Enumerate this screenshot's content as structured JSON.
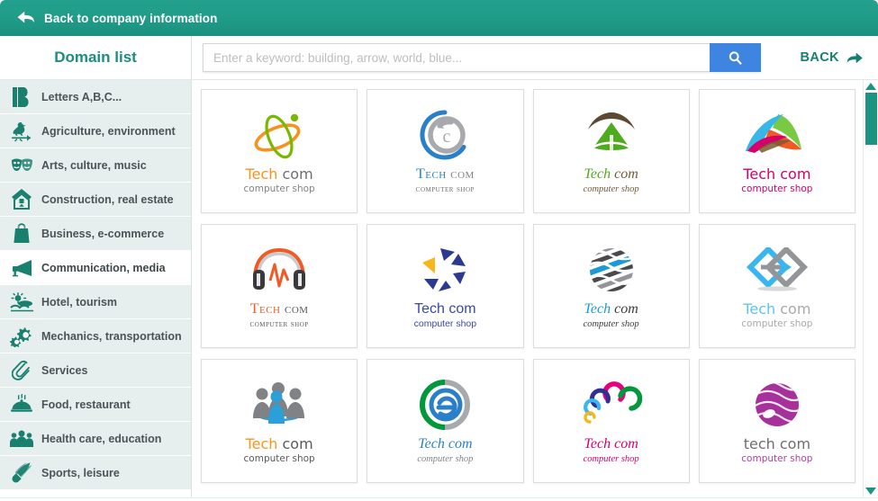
{
  "topbar": {
    "back_label": "Back to company information",
    "back_icon": "back-arrow-icon",
    "bg_color": "#1f9b88"
  },
  "sidebar": {
    "title": "Domain list",
    "title_color": "#1b8e7d",
    "items": [
      {
        "label": "Letters A,B,C...",
        "icon": "letter-b-icon",
        "active": false
      },
      {
        "label": "Agriculture, environment",
        "icon": "rooster-vane-icon",
        "active": false
      },
      {
        "label": "Arts, culture, music",
        "icon": "theatre-masks-icon",
        "active": false
      },
      {
        "label": "Construction, real estate",
        "icon": "house-icon",
        "active": false
      },
      {
        "label": "Business, e-commerce",
        "icon": "shopping-bag-icon",
        "active": false
      },
      {
        "label": "Communication, media",
        "icon": "megaphone-icon",
        "active": true
      },
      {
        "label": "Hotel, tourism",
        "icon": "beach-sun-icon",
        "active": false
      },
      {
        "label": "Mechanics, transportation",
        "icon": "gears-icon",
        "active": false
      },
      {
        "label": "Services",
        "icon": "paperclip-icon",
        "active": false
      },
      {
        "label": "Food, restaurant",
        "icon": "food-cloche-icon",
        "active": false
      },
      {
        "label": "Health care, education",
        "icon": "people-group-icon",
        "active": false
      },
      {
        "label": "Sports, leisure",
        "icon": "shuttlecock-icon",
        "active": false
      }
    ]
  },
  "search": {
    "value": "",
    "placeholder": "Enter a keyword: building, arrow, world, blue...",
    "button_icon": "search-icon",
    "button_color": "#3d85e0"
  },
  "back_right": {
    "label": "BACK",
    "icon": "arrow-right-icon",
    "color": "#16806f"
  },
  "scrollbar": {
    "up_icon": "triangle-up-icon",
    "down_icon": "triangle-down-icon",
    "thumb_color": "#1d9382"
  },
  "logos": [
    {
      "id": "atom-orbit",
      "mark_icon": "atom-orbit-icon",
      "name_part1": "Tech",
      "name_part2": "com",
      "tagline": "computer shop",
      "color1": "#f6921e",
      "color2": "#7ab800",
      "name1_color": "#f6921e",
      "name2_color": "#6d6e71",
      "tagline_color": "#808285",
      "font_style": "round"
    },
    {
      "id": "c-circle",
      "mark_icon": "c-circle-icon",
      "name_part1": "Tech",
      "name_part2": "com",
      "tagline": "computer shop",
      "color1": "#2a7fc9",
      "color2": "#a7a9ac",
      "name1_color": "#2a7fc9",
      "name2_color": "#808285",
      "tagline_color": "#6d6e71",
      "font_style": "serif"
    },
    {
      "id": "green-tent",
      "mark_icon": "tent-tree-icon",
      "name_part1": "Tech",
      "name_part2": "com",
      "tagline": "computer shop",
      "color1": "#5a4a2f",
      "color2": "#4faa1e",
      "name1_color": "#4faa1e",
      "name2_color": "#6e5c3a",
      "tagline_color": "#6e5c3a",
      "font_style": "ital"
    },
    {
      "id": "color-wings",
      "mark_icon": "colored-wings-icon",
      "name_part1": "Tech",
      "name_part2": "com",
      "tagline": "computer shop",
      "color1": "#e6007e",
      "color2": "#7ac943",
      "name1_color": "#d4006a",
      "name2_color": "#d4006a",
      "tagline_color": "#d4006a",
      "font_style": "round"
    },
    {
      "id": "headphones",
      "mark_icon": "headphones-icon",
      "name_part1": "Tech",
      "name_part2": "com",
      "tagline": "computer shop",
      "color1": "#f15a24",
      "color2": "#58595b",
      "name1_color": "#f15a24",
      "name2_color": "#58595b",
      "tagline_color": "#58595b",
      "font_style": "serif"
    },
    {
      "id": "blue-triangles",
      "mark_icon": "triangle-burst-icon",
      "name_part1": "Tech",
      "name_part2": "com",
      "tagline": "computer shop",
      "color1": "#2b3990",
      "color2": "#f5b818",
      "name1_color": "#3a4a9e",
      "name2_color": "#3a4a9e",
      "tagline_color": "#3a4a9e",
      "font_style": "sans"
    },
    {
      "id": "striped-globe",
      "mark_icon": "striped-globe-icon",
      "name_part1": "Tech",
      "name_part2": "com",
      "tagline": "computer shop",
      "color1": "#1b9ad6",
      "color2": "#808285",
      "name1_color": "#1b9ad6",
      "name2_color": "#3b3b3b",
      "tagline_color": "#3b3b3b",
      "font_style": "ital"
    },
    {
      "id": "arrow-squares",
      "mark_icon": "arrow-squares-icon",
      "name_part1": "Tech",
      "name_part2": "com",
      "tagline": "computer shop",
      "color1": "#39b6ef",
      "color2": "#939598",
      "name1_color": "#5bc4f1",
      "name2_color": "#a7a9ac",
      "tagline_color": "#a7a9ac",
      "font_style": "round"
    },
    {
      "id": "people-group",
      "mark_icon": "people-crowd-icon",
      "name_part1": "Tech",
      "name_part2": "com",
      "tagline": "computer shop",
      "color1": "#808285",
      "color2": "#2b9fd8",
      "name1_color": "#f7941e",
      "name2_color": "#58595b",
      "tagline_color": "#58595b",
      "font_style": "round"
    },
    {
      "id": "e-circle",
      "mark_icon": "e-circle-icon",
      "name_part1": "Tech",
      "name_part2": "com",
      "tagline": "computer shop",
      "color1": "#00983a",
      "color2": "#a7a9ac",
      "name1_color": "#2a7fc9",
      "name2_color": "#2a7fc9",
      "tagline_color": "#808285",
      "font_style": "ital"
    },
    {
      "id": "pink-flower",
      "mark_icon": "flower-arcs-icon",
      "name_part1": "Tech",
      "name_part2": "com",
      "tagline": "computer shop",
      "color1": "#e6007e",
      "color2": "#00983a",
      "name1_color": "#d6006c",
      "name2_color": "#d6006c",
      "tagline_color": "#d6006c",
      "font_style": "ital"
    },
    {
      "id": "purple-sphere",
      "mark_icon": "purple-sphere-icon",
      "name_part1": "tech",
      "name_part2": "com",
      "tagline": "computer shop",
      "color1": "#a6319b",
      "color2": "#c060bb",
      "name1_color": "#6d6e71",
      "name2_color": "#6d6e71",
      "tagline_color": "#b2409f",
      "font_style": "round"
    }
  ]
}
